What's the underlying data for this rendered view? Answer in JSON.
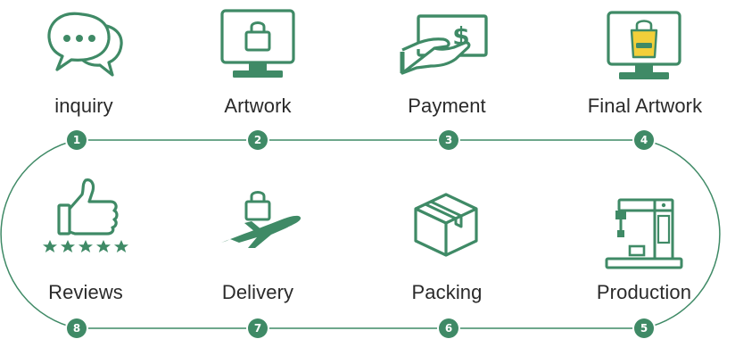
{
  "colors": {
    "primary": "#3f8a66",
    "light": "#a9d2be",
    "accent": "#f2cf3a",
    "text": "#2a2a2a"
  },
  "steps": [
    {
      "number": "1",
      "label": "inquiry",
      "icon": "chat-bubbles-icon"
    },
    {
      "number": "2",
      "label": "Artwork",
      "icon": "monitor-bag-icon"
    },
    {
      "number": "3",
      "label": "Payment",
      "icon": "hand-money-icon"
    },
    {
      "number": "4",
      "label": "Final Artwork",
      "icon": "monitor-tote-bag-icon"
    },
    {
      "number": "5",
      "label": "Production",
      "icon": "sewing-machine-icon"
    },
    {
      "number": "6",
      "label": "Packing",
      "icon": "box-icon"
    },
    {
      "number": "7",
      "label": "Delivery",
      "icon": "airplane-bag-icon"
    },
    {
      "number": "8",
      "label": "Reviews",
      "icon": "thumbs-up-stars-icon"
    }
  ]
}
